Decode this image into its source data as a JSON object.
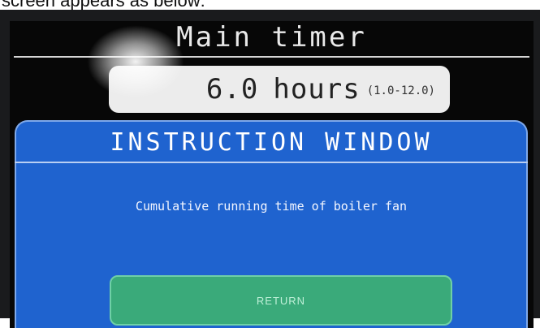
{
  "document": {
    "caption": "screen appears as below:"
  },
  "screen": {
    "title": "Main timer",
    "value": "6.0",
    "unit": "hours",
    "range": "(1.0-12.0)",
    "panel_title": "INSTRUCTION WINDOW",
    "instruction": "Cumulative running time of boiler fan",
    "return_label": "RETURN"
  },
  "colors": {
    "panel": "#1f63cf",
    "button": "#3aaa7a",
    "screen": "#070707"
  }
}
